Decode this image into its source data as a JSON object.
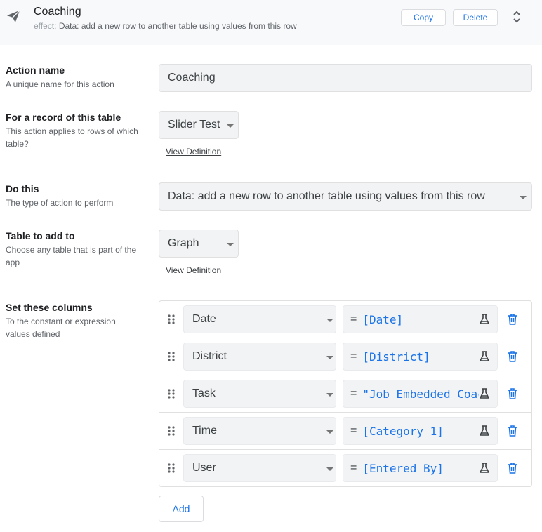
{
  "header": {
    "title": "Coaching",
    "subtitle_label": "effect:",
    "subtitle_text": "Data: add a new row to another table using values from this row",
    "copy_label": "Copy",
    "delete_label": "Delete",
    "icon": "paper-plane-icon",
    "expand_icon": "unfold-icon"
  },
  "action_name": {
    "title": "Action name",
    "desc": "A unique name for this action",
    "value": "Coaching"
  },
  "record_table": {
    "title": "For a record of this table",
    "desc": "This action applies to rows of which table?",
    "value": "Slider Test",
    "link": "View Definition"
  },
  "do_this": {
    "title": "Do this",
    "desc": "The type of action to perform",
    "value": "Data: add a new row to another table using values from this row"
  },
  "table_to_add": {
    "title": "Table to add to",
    "desc": "Choose any table that is part of the app",
    "value": "Graph",
    "link": "View Definition"
  },
  "set_columns": {
    "title": "Set these columns",
    "desc": "To the constant or expression values defined",
    "rows": [
      {
        "column": "Date",
        "expression": "[Date]"
      },
      {
        "column": "District",
        "expression": "[District]"
      },
      {
        "column": "Task",
        "expression": "\"Job Embedded Coaching\""
      },
      {
        "column": "Time",
        "expression": "[Category 1]"
      },
      {
        "column": "User",
        "expression": "[Entered By]"
      }
    ],
    "eq_sign": "=",
    "add_label": "Add"
  },
  "colors": {
    "accent": "#1a73e8",
    "field_bg": "#f1f3f4",
    "header_bg": "#f8f9fa"
  }
}
